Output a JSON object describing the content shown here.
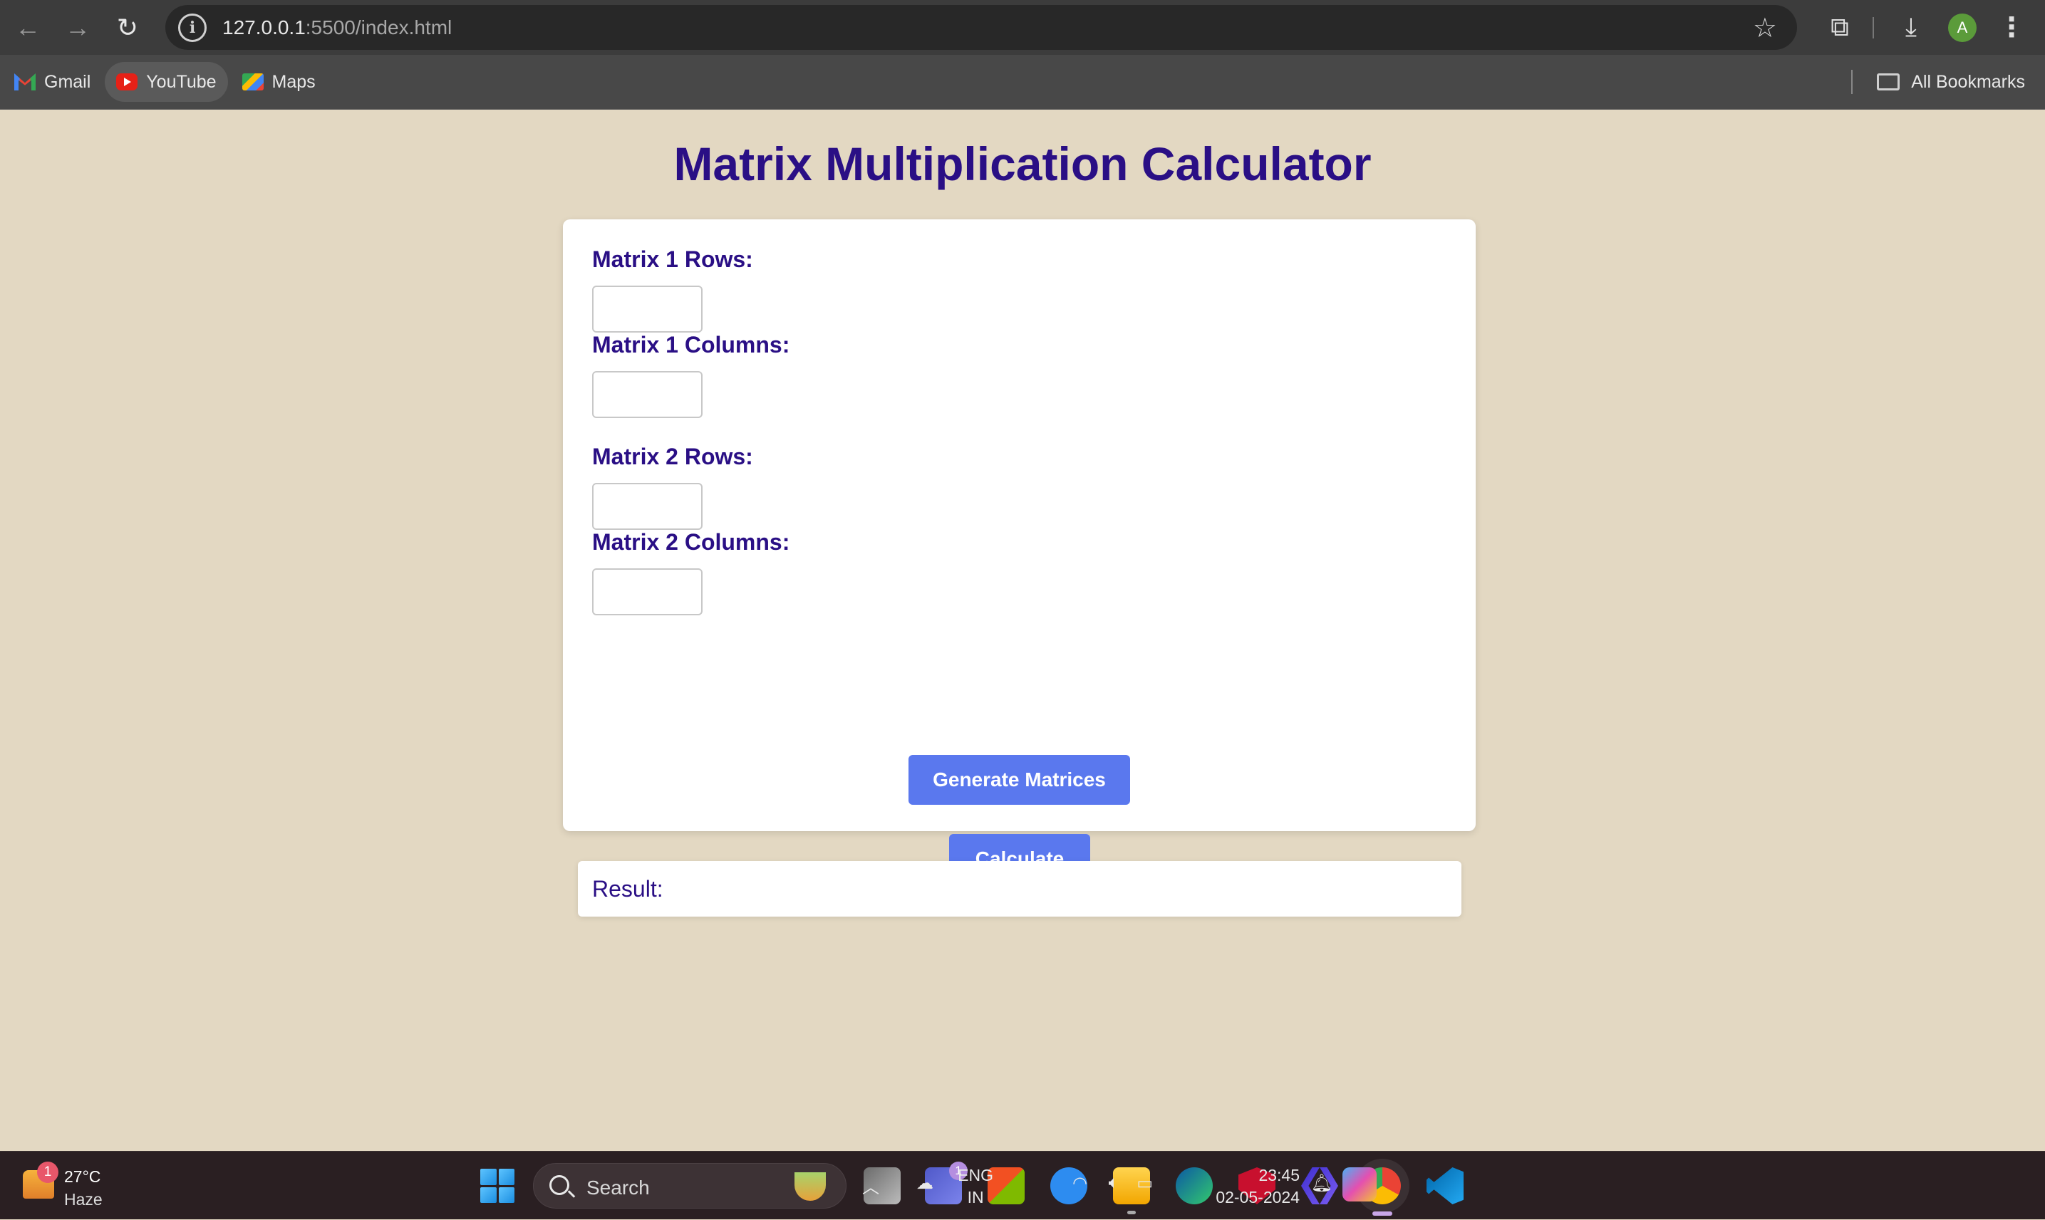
{
  "browser": {
    "url_host": "127.0.0.1",
    "url_rest": ":5500/index.html",
    "profile_initial": "A",
    "bookmarks": [
      {
        "label": "Gmail",
        "icon": "gmail-icon"
      },
      {
        "label": "YouTube",
        "icon": "youtube-icon"
      },
      {
        "label": "Maps",
        "icon": "maps-icon"
      }
    ],
    "all_bookmarks_label": "All Bookmarks"
  },
  "page": {
    "title": "Matrix Multiplication Calculator",
    "fields": [
      {
        "label": "Matrix 1 Rows:",
        "value": ""
      },
      {
        "label": "Matrix 1 Columns:",
        "value": ""
      },
      {
        "label": "Matrix 2 Rows:",
        "value": ""
      },
      {
        "label": "Matrix 2 Columns:",
        "value": ""
      }
    ],
    "generate_button": "Generate Matrices",
    "calculate_button": "Calculate",
    "result_label": "Result:"
  },
  "colors": {
    "page_bg": "#e3d8c2",
    "heading": "#2a0f85",
    "button": "#5a78ee"
  },
  "taskbar": {
    "weather": {
      "temp": "27°C",
      "condition": "Haze",
      "badge": "1"
    },
    "search_placeholder": "Search",
    "teams_badge": "1",
    "apps": [
      "task-view-icon",
      "teams-icon",
      "store-icon",
      "help-icon",
      "file-explorer-icon",
      "edge-icon",
      "mcafee-icon",
      "dev-tool-icon",
      "chrome-icon",
      "vscode-icon"
    ],
    "lang_line1": "ENG",
    "lang_line2": "IN",
    "time": "23:45",
    "date": "02-05-2024"
  }
}
